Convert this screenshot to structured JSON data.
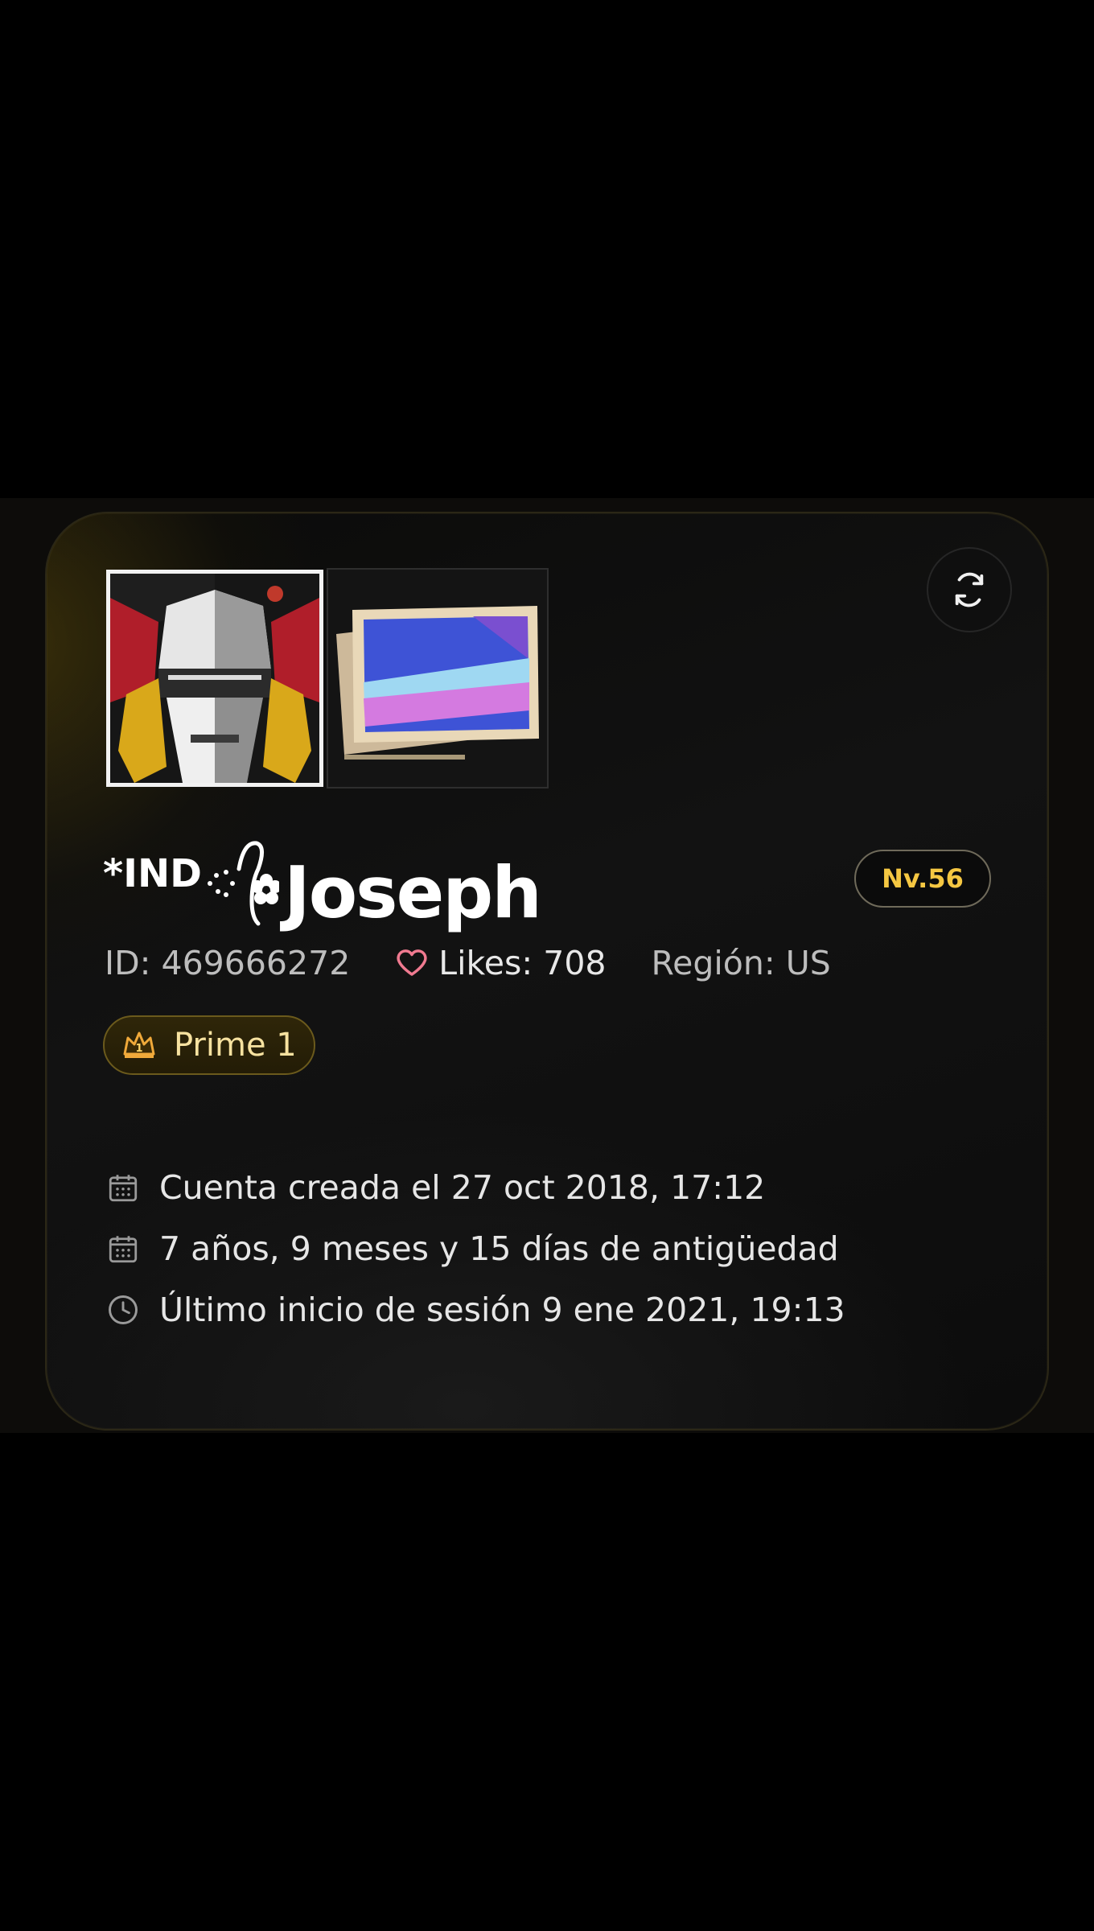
{
  "profile": {
    "nickname_prefix": "*IND",
    "nickname_main": "Joseph",
    "level": "Nv.56",
    "id_text": "ID: 469666272",
    "likes_text": "Likes: 708",
    "region_text": "Región: US",
    "prime_label": "Prime 1",
    "prime_badge_number": "1"
  },
  "info": {
    "created": "Cuenta creada el 27 oct 2018, 17:12",
    "age": "7 años, 9 meses y 15 días de antigüedad",
    "last_login": "Último inicio de sesión 9 ene 2021, 19:13"
  },
  "icons": {
    "refresh": "refresh-icon",
    "heart": "heart-icon",
    "crown": "crown-icon",
    "calendar": "calendar-icon",
    "clock": "clock-icon"
  },
  "colors": {
    "accent_gold": "#f5c742",
    "heart_pink": "#f07a90",
    "prime_text": "#f7e2a0"
  }
}
